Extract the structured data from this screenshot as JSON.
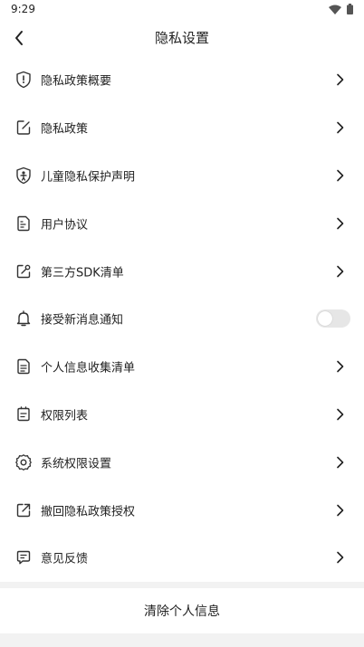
{
  "status_bar": {
    "time": "9:29",
    "icons": [
      "wifi-icon",
      "battery-icon"
    ]
  },
  "header": {
    "title": "隐私设置",
    "back_icon": "chevron-left-icon"
  },
  "menu": {
    "items": [
      {
        "label": "隐私政策概要",
        "icon": "shield-alert-icon",
        "control": "chevron"
      },
      {
        "label": "隐私政策",
        "icon": "edit-document-icon",
        "control": "chevron"
      },
      {
        "label": "儿童隐私保护声明",
        "icon": "shield-child-icon",
        "control": "chevron"
      },
      {
        "label": "用户协议",
        "icon": "document-icon",
        "control": "chevron"
      },
      {
        "label": "第三方SDK清单",
        "icon": "external-edit-icon",
        "control": "chevron"
      },
      {
        "label": "接受新消息通知",
        "icon": "bell-icon",
        "control": "toggle",
        "toggle_on": false
      },
      {
        "label": "个人信息收集清单",
        "icon": "list-document-icon",
        "control": "chevron"
      },
      {
        "label": "权限列表",
        "icon": "permission-list-icon",
        "control": "chevron"
      },
      {
        "label": "系统权限设置",
        "icon": "gear-icon",
        "control": "chevron"
      },
      {
        "label": "撤回隐私政策授权",
        "icon": "withdraw-icon",
        "control": "chevron"
      },
      {
        "label": "意见反馈",
        "icon": "feedback-icon",
        "control": "chevron"
      }
    ]
  },
  "clear_button": {
    "label": "清除个人信息"
  },
  "colors": {
    "text": "#222222",
    "background": "#f2f2f2",
    "surface": "#ffffff",
    "toggle_off": "#e6e6e6"
  }
}
